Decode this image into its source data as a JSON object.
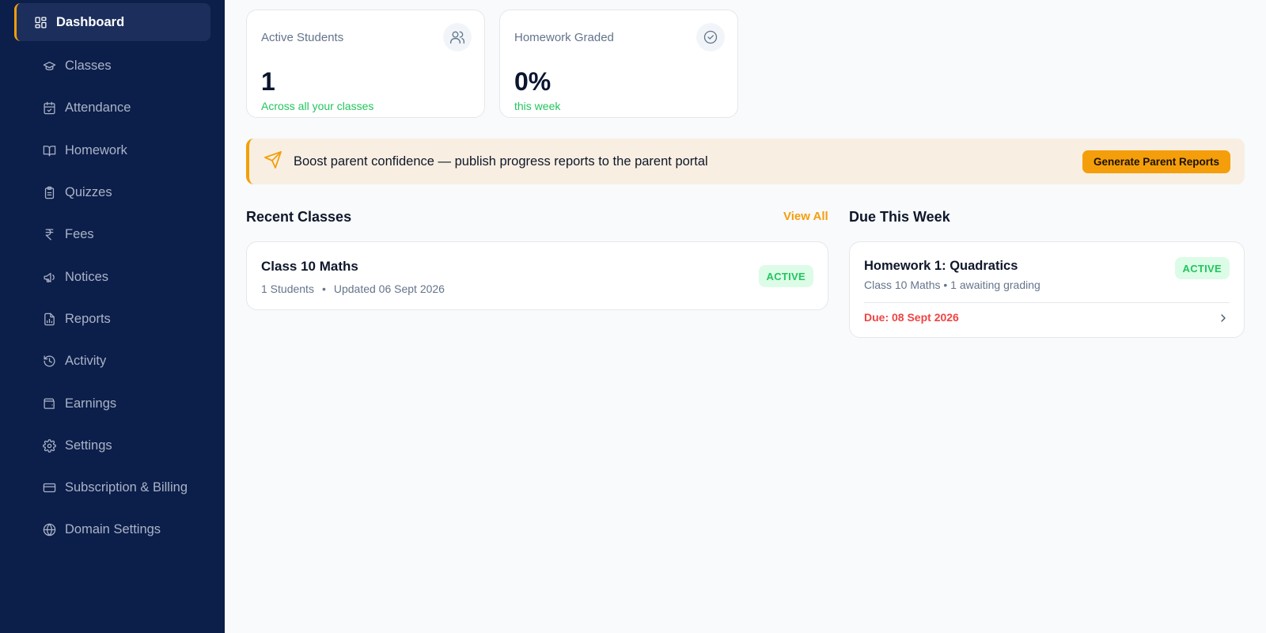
{
  "sidebar": {
    "items": [
      {
        "label": "Dashboard",
        "icon": "dashboard-icon"
      },
      {
        "label": "Classes",
        "icon": "graduation-cap-icon"
      },
      {
        "label": "Attendance",
        "icon": "calendar-check-icon"
      },
      {
        "label": "Homework",
        "icon": "book-open-icon"
      },
      {
        "label": "Quizzes",
        "icon": "clipboard-icon"
      },
      {
        "label": "Fees",
        "icon": "rupee-icon"
      },
      {
        "label": "Notices",
        "icon": "megaphone-icon"
      },
      {
        "label": "Reports",
        "icon": "file-chart-icon"
      },
      {
        "label": "Activity",
        "icon": "history-icon"
      },
      {
        "label": "Earnings",
        "icon": "wallet-icon"
      },
      {
        "label": "Settings",
        "icon": "gear-icon"
      },
      {
        "label": "Subscription & Billing",
        "icon": "credit-card-icon"
      },
      {
        "label": "Domain Settings",
        "icon": "globe-icon"
      }
    ],
    "active_index": 0
  },
  "stats": [
    {
      "label": "Active Students",
      "value": "1",
      "sub": "Across all your classes",
      "icon": "users-icon"
    },
    {
      "label": "Homework Graded",
      "value": "0%",
      "sub": "this week",
      "icon": "check-circle-icon"
    }
  ],
  "banner": {
    "text": "Boost parent confidence — publish progress reports to the parent portal",
    "cta": "Generate Parent Reports",
    "icon": "send-icon"
  },
  "recent_classes": {
    "title": "Recent Classes",
    "view_all": "View All",
    "items": [
      {
        "name": "Class 10 Maths",
        "students": "1 Students",
        "dot": "•",
        "updated": "Updated 06 Sept 2026",
        "status": "ACTIVE"
      }
    ]
  },
  "due_this_week": {
    "title": "Due This Week",
    "items": [
      {
        "name": "Homework 1: Quadratics",
        "meta": "Class 10 Maths • 1 awaiting grading",
        "status": "ACTIVE",
        "due": "Due: 08 Sept 2026"
      }
    ]
  },
  "colors": {
    "sidebar_bg": "#0c1e4a",
    "accent": "#f59e0b",
    "success": "#22c55e",
    "danger": "#ef4444"
  }
}
